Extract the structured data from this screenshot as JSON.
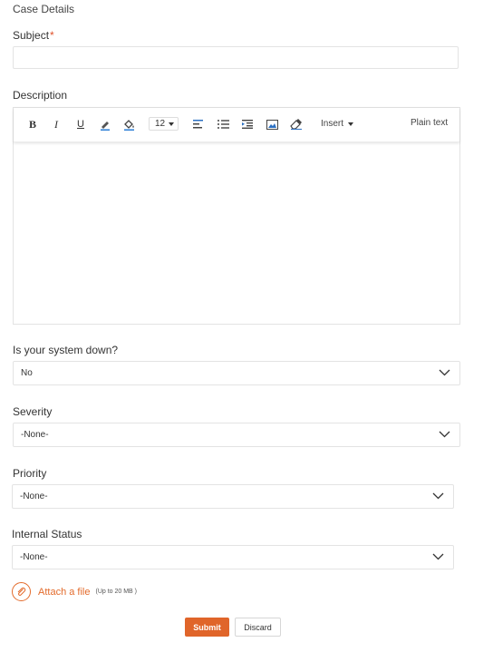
{
  "section_title": "Case Details",
  "subject": {
    "label": "Subject",
    "required_mark": "*",
    "value": ""
  },
  "description": {
    "label": "Description",
    "toolbar": {
      "bold": "B",
      "italic": "I",
      "underline": "U",
      "font_size": "12",
      "insert_label": "Insert",
      "plain_text_label": "Plain text"
    },
    "value": ""
  },
  "system_down": {
    "label": "Is your system down?",
    "selected": "No"
  },
  "severity": {
    "label": "Severity",
    "selected": "-None-"
  },
  "priority": {
    "label": "Priority",
    "selected": "-None-"
  },
  "internal_status": {
    "label": "Internal Status",
    "selected": "-None-"
  },
  "attach": {
    "label": "Attach a file",
    "note": "(Up to 20 MB )"
  },
  "actions": {
    "submit_label": "Submit",
    "discard_label": "Discard"
  },
  "colors": {
    "accent": "#e0652a",
    "required": "#e0522c",
    "border": "#e3e3e3"
  }
}
